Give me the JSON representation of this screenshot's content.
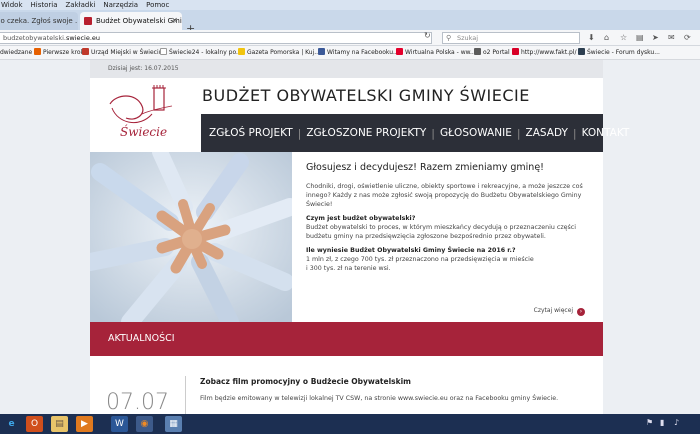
{
  "menu": [
    "Widok",
    "Historia",
    "Zakładki",
    "Narzędzia",
    "Pomoc"
  ],
  "tabs": [
    {
      "label": "po czeka. Zgłoś swoje ...",
      "active": false
    },
    {
      "label": "Budżet Obywatelski Gminy...",
      "active": true
    }
  ],
  "new_tab_label": "+",
  "url": {
    "prefix": "budzetobywatelski.",
    "host": "swiecie.eu"
  },
  "search": {
    "placeholder": "Szukaj"
  },
  "bookmarks": [
    {
      "label": "dwiedzane",
      "color": "#f5f6f8"
    },
    {
      "label": "Pierwsze kroki",
      "color": "#e66000"
    },
    {
      "label": "Urząd Miejski w Świeciu",
      "color": "#c0392b"
    },
    {
      "label": "Świecie24 - lokalny po...",
      "color": "#ffffff"
    },
    {
      "label": "Gazeta Pomorska | Kuj...",
      "color": "#f1c40f"
    },
    {
      "label": "Witamy na Facebooku...",
      "color": "#3b5998"
    },
    {
      "label": "Wirtualna Polska - ww...",
      "color": "#e4002b"
    },
    {
      "label": "o2 Portal",
      "color": "#5b5b5b"
    },
    {
      "label": "http://www.fakt.pl/",
      "color": "#d80027"
    },
    {
      "label": "Świecie - Forum dysku...",
      "color": "#2c3e50"
    }
  ],
  "page": {
    "date_label": "Dzisiaj jest: 16.07.2015",
    "logo_text": "Świecie",
    "site_title": "BUDŻET OBYWATELSKI GMINY ŚWIECIE",
    "nav": [
      "ZGŁOŚ PROJEKT",
      "ZGŁOSZONE PROJEKTY",
      "GŁOSOWANIE",
      "ZASADY",
      "KONTAKT"
    ],
    "hero": {
      "heading": "Głosujesz i decydujesz! Razem zmieniamy gminę!",
      "intro": "Chodniki, drogi, oświetlenie uliczne, obiekty sportowe i rekreacyjne, a może jeszcze coś innego? Każdy z nas może zgłosić swoją propozycję do Budżetu Obywatelskiego Gminy Świecie!",
      "q1": "Czym jest budżet obywatelski?",
      "a1": "Budżet obywatelski to proces, w którym mieszkańcy decydują o przeznaczeniu części budżetu gminy na przedsięwzięcia zgłoszone bezpośrednio przez obywateli.",
      "q2": "Ile wyniesie Budżet Obywatelski Gminy Świecie na 2016 r.?",
      "a2a": "1 mln zł, z czego 700 tys. zł przeznaczono na przedsięwzięcia w mieście",
      "a2b": "i 300 tys. zł na terenie wsi.",
      "more": "Czytaj więcej",
      "more_icon": "›"
    },
    "news": {
      "section_title": "AKTUALNOŚCI",
      "date": "07.07",
      "title": "Zobacz film promocyjny o Budżecie Obywatelskim",
      "body": "Film będzie emitowany w telewizji lokalnej TV CSW, na stronie www.swiecie.eu oraz na Facebooku gminy Świecie."
    }
  },
  "toolbar_icons": [
    "download-icon",
    "home-icon",
    "star-icon",
    "bookmarks-icon",
    "shield-icon",
    "pocket-icon",
    "send-icon",
    "chat-icon",
    "sync-icon"
  ],
  "taskbar": {
    "apps": [
      "e",
      "O",
      "▤",
      "▶",
      "W",
      "◉",
      "▦"
    ]
  },
  "colors": {
    "accent": "#a6233a",
    "nav_bg": "#2c2f38"
  }
}
